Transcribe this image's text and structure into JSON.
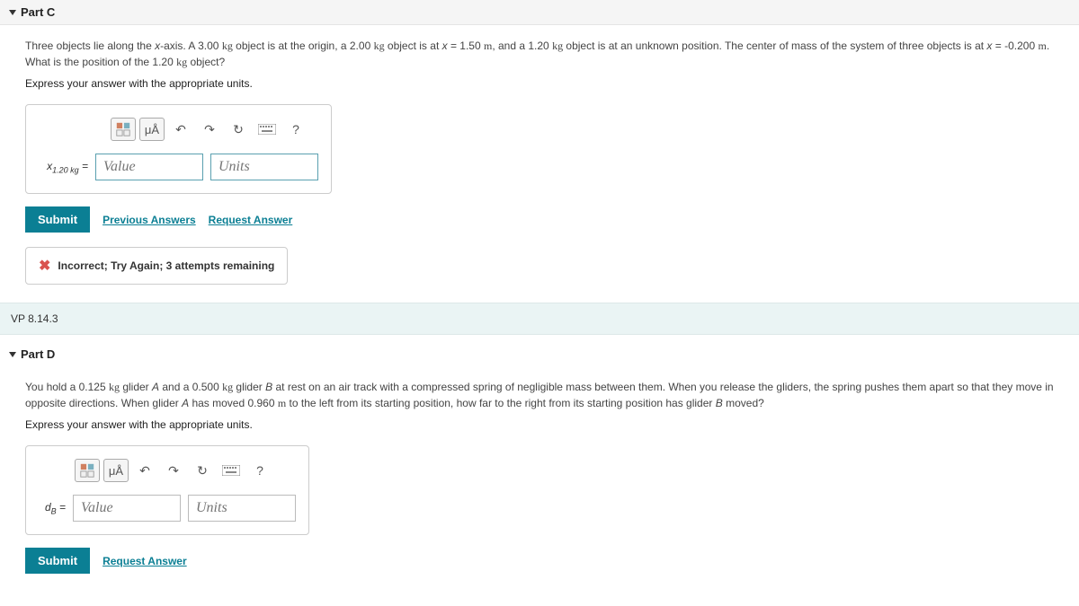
{
  "partC": {
    "title": "Part C",
    "prompt_prefix": "Three objects lie along the ",
    "prompt_var1": "x",
    "prompt_mid1": "-axis. A 3.00 ",
    "kg1": "kg",
    "prompt_mid2": " object is at the origin, a 2.00 ",
    "kg2": "kg",
    "prompt_mid3": " object is at ",
    "var_x1": "x",
    "prompt_mid4": " = 1.50 ",
    "m1": "m",
    "prompt_mid5": ", and a 1.20 ",
    "kg3": "kg",
    "prompt_mid6": " object is at an unknown position. The center of mass of the system of three objects is at ",
    "var_x2": "x",
    "prompt_mid7": " = -0.200 ",
    "m2": "m",
    "prompt_mid8": ". What is the position of the 1.20 ",
    "kg4": "kg",
    "prompt_end": " object?",
    "instruction": "Express your answer with the appropriate units.",
    "toolbar": {
      "mu": "μÅ",
      "help": "?"
    },
    "input": {
      "label_prefix": "x",
      "label_sub": "1.20 kg",
      "label_suffix": " =",
      "value_ph": "Value",
      "units_ph": "Units"
    },
    "buttons": {
      "submit": "Submit",
      "prev": "Previous Answers",
      "req": "Request Answer"
    },
    "feedback": "Incorrect; Try Again; 3 attempts remaining"
  },
  "vp": {
    "label": "VP 8.14.3"
  },
  "partD": {
    "title": "Part D",
    "prompt_prefix": "You hold a 0.125 ",
    "kg1": "kg",
    "prompt_mid1": " glider ",
    "varA": "A",
    "prompt_mid2": " and a 0.500 ",
    "kg2": "kg",
    "prompt_mid3": " glider ",
    "varB": "B",
    "prompt_mid4": " at rest on an air track with a compressed spring of negligible mass between them. When you release the gliders, the spring pushes them apart so that they move in opposite directions. When glider ",
    "varA2": "A",
    "prompt_mid5": " has moved 0.960 ",
    "m1": "m",
    "prompt_mid6": " to the left from its starting position, how far to the right from its starting position has glider ",
    "varB2": "B",
    "prompt_end": " moved?",
    "instruction": "Express your answer with the appropriate units.",
    "toolbar": {
      "mu": "μÅ",
      "help": "?"
    },
    "input": {
      "label_prefix": "d",
      "label_sub": "B",
      "label_suffix": " =",
      "value_ph": "Value",
      "units_ph": "Units"
    },
    "buttons": {
      "submit": "Submit",
      "req": "Request Answer"
    }
  }
}
